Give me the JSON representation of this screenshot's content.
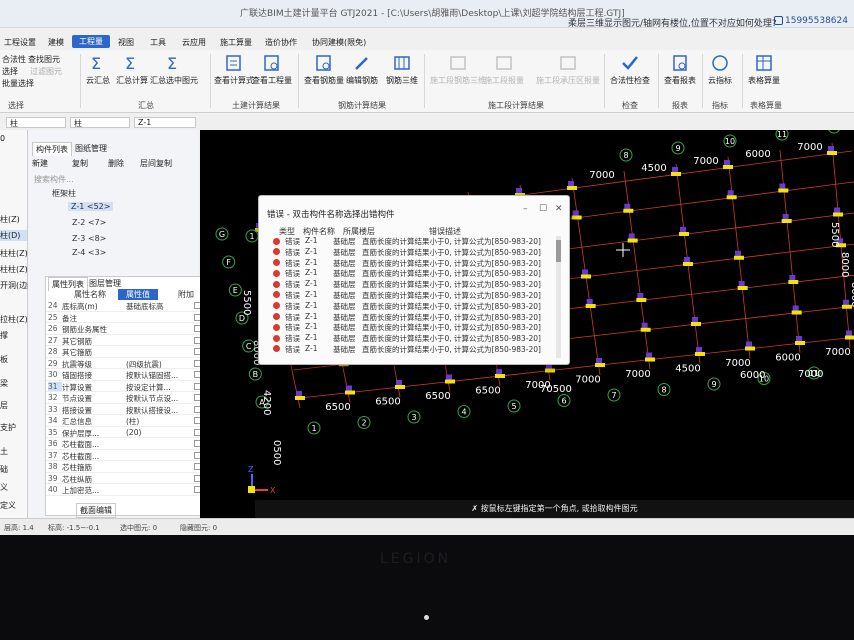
{
  "window": {
    "app_title": "广联达BIM土建计量平台 GTJ2021 - [C:\\Users\\胡雅雨\\Desktop\\上课\\刘超学院结构层工程.GTJ]",
    "notice": "柔层三维显示图元/轴网有楼位,位置不对应如何处理?",
    "phone": "15995538624"
  },
  "menu": [
    "工程设置",
    "建模",
    "工程量",
    "视图",
    "工具",
    "云应用",
    "施工算量",
    "造价协作",
    "协同建模(限免)"
  ],
  "menu_active": "工程量",
  "ribbon": {
    "left_cmds": [
      "合法性",
      "查找图元",
      "选择",
      "过滤图元",
      "批量选择"
    ],
    "group_select": "选择",
    "buttons_calc": [
      "云汇总",
      "汇总计算",
      "汇总选中图元"
    ],
    "group_calc": "汇总",
    "buttons_civil": [
      "查看计算式",
      "查看工程量"
    ],
    "group_civil": "土建计算结果",
    "buttons_rebar": [
      "查看钢筋量",
      "编辑钢筋",
      "钢筋三维"
    ],
    "group_rebar": "钢筋计算结果",
    "buttons_const": [
      "施工段钢筋三维",
      "施工段报量",
      "施工段承压区报量"
    ],
    "group_const": "施工段计算结果",
    "buttons_check": [
      "合法性检查"
    ],
    "group_check": "检查",
    "buttons_report": [
      "查看报表"
    ],
    "group_report": "报表",
    "buttons_index": [
      "云指标"
    ],
    "group_index": "指标",
    "buttons_table": [
      "表格算量"
    ],
    "group_table": "表格算量"
  },
  "selectors": [
    "柱",
    "柱",
    "Z-1"
  ],
  "left_edge_items": [
    "0",
    "柱(Z)",
    "柱(D)",
    "柱柱(Z)",
    "柱柱(Z)",
    "开洞(边缘非..",
    "拉柱(Z)",
    "撑",
    "板",
    "梁",
    "层",
    "支护",
    "土",
    "础",
    "义",
    "定义"
  ],
  "panel": {
    "tabs": [
      "构件列表",
      "图纸管理"
    ],
    "tools": [
      "新建",
      "复制",
      "删除",
      "层间复制"
    ],
    "search_placeholder": "搜索构件...",
    "tree_root": "框架柱",
    "tree_items": [
      "Z-1 <52>",
      "Z-2 <7>",
      "Z-3 <8>",
      "Z-4 <3>"
    ]
  },
  "props": {
    "tabs": [
      "属性列表",
      "图层管理"
    ],
    "headers": [
      "属性名称",
      "属性值",
      "附加"
    ],
    "rows": [
      {
        "no": "24",
        "name": "底标高(m)",
        "value": "基础底标高"
      },
      {
        "no": "25",
        "name": "备注",
        "value": ""
      },
      {
        "no": "26",
        "name": "钢筋业务属性",
        "value": ""
      },
      {
        "no": "27",
        "name": "其它钢筋",
        "value": ""
      },
      {
        "no": "28",
        "name": "其它箍筋",
        "value": ""
      },
      {
        "no": "29",
        "name": "抗震等级",
        "value": "(四级抗震)"
      },
      {
        "no": "30",
        "name": "锚固搭接",
        "value": "按默认锚固搭..."
      },
      {
        "no": "31",
        "name": "计算设置",
        "value": "按设定计算..."
      },
      {
        "no": "32",
        "name": "节点设置",
        "value": "按默认节点设..."
      },
      {
        "no": "33",
        "name": "搭接设置",
        "value": "按默认搭接设..."
      },
      {
        "no": "34",
        "name": "汇总信息",
        "value": "(柱)"
      },
      {
        "no": "35",
        "name": "保护层厚...",
        "value": "(20)"
      },
      {
        "no": "36",
        "name": "芯柱截面...",
        "value": ""
      },
      {
        "no": "37",
        "name": "芯柱截面...",
        "value": ""
      },
      {
        "no": "38",
        "name": "芯柱箍筋",
        "value": ""
      },
      {
        "no": "39",
        "name": "芯柱纵筋",
        "value": ""
      },
      {
        "no": "40",
        "name": "上加密范...",
        "value": ""
      }
    ],
    "bottom_tab": "截面编辑"
  },
  "dialog": {
    "title": "错误 - 双击构件名称选择出错构件",
    "columns": [
      "类型",
      "构件名称",
      "所属楼层",
      "错误描述"
    ],
    "rows": [
      {
        "type": "错误",
        "name": "Z-1",
        "floor": "基础层",
        "desc": "直筋长度的计算结果小于0, 计算公式为[850-983-20]"
      },
      {
        "type": "错误",
        "name": "Z-1",
        "floor": "基础层",
        "desc": "直筋长度的计算结果小于0, 计算公式为[850-983-20]"
      },
      {
        "type": "错误",
        "name": "Z-1",
        "floor": "基础层",
        "desc": "直筋长度的计算结果小于0, 计算公式为[850-983-20]"
      },
      {
        "type": "错误",
        "name": "Z-1",
        "floor": "基础层",
        "desc": "直筋长度的计算结果小于0, 计算公式为[850-983-20]"
      },
      {
        "type": "错误",
        "name": "Z-1",
        "floor": "基础层",
        "desc": "直筋长度的计算结果小于0, 计算公式为[850-983-20]"
      },
      {
        "type": "错误",
        "name": "Z-1",
        "floor": "基础层",
        "desc": "直筋长度的计算结果小于0, 计算公式为[850-983-20]"
      },
      {
        "type": "错误",
        "name": "Z-1",
        "floor": "基础层",
        "desc": "直筋长度的计算结果小于0, 计算公式为[850-983-20]"
      },
      {
        "type": "错误",
        "name": "Z-1",
        "floor": "基础层",
        "desc": "直筋长度的计算结果小于0, 计算公式为[850-983-20]"
      },
      {
        "type": "错误",
        "name": "Z-1",
        "floor": "基础层",
        "desc": "直筋长度的计算结果小于0, 计算公式为[850-983-20]"
      },
      {
        "type": "错误",
        "name": "Z-1",
        "floor": "基础层",
        "desc": "直筋长度的计算结果小于0, 计算公式为[850-983-20]"
      },
      {
        "type": "错误",
        "name": "Z-1",
        "floor": "基础层",
        "desc": "直筋长度的计算结果小于0, 计算公式为[850-983-20]"
      }
    ]
  },
  "cad": {
    "top_axes": [
      "8",
      "9",
      "10",
      "11",
      "12"
    ],
    "top_dims": [
      "7000",
      "4500",
      "7000",
      "6000",
      "7000"
    ],
    "bottom_axes": [
      "1",
      "2",
      "3",
      "4",
      "5",
      "6",
      "7",
      "8",
      "9",
      "10",
      "11"
    ],
    "bottom_dims": [
      "6500",
      "6500",
      "6500",
      "6500",
      "7000",
      "7000",
      "7000",
      "4500",
      "7000",
      "6000",
      "7000"
    ],
    "left_axes": [
      "G",
      "F",
      "E",
      "D",
      "C",
      "B",
      "A"
    ],
    "left_dims": [
      "5500",
      "8000",
      "4200",
      "0500"
    ],
    "right_dims": [
      "5500",
      "8000",
      "8000"
    ],
    "extra_dims": [
      "6000",
      "7000",
      "70500"
    ],
    "axis_label_top_left": "1"
  },
  "hint": "按鼠标左键指定第一个角点, 或拾取构件图元",
  "status": [
    "层高: 1.4",
    "标高: -1.5~-0.1",
    "选中图元: 0",
    "隐藏图元: 0"
  ],
  "bezel_brand": "LEGION",
  "colors": {
    "accent": "#2d66c9",
    "grid_red": "#d23a2a",
    "column_yellow": "#f2e600",
    "column_purple": "#6a37d8",
    "axis_green": "#2ea84a"
  }
}
